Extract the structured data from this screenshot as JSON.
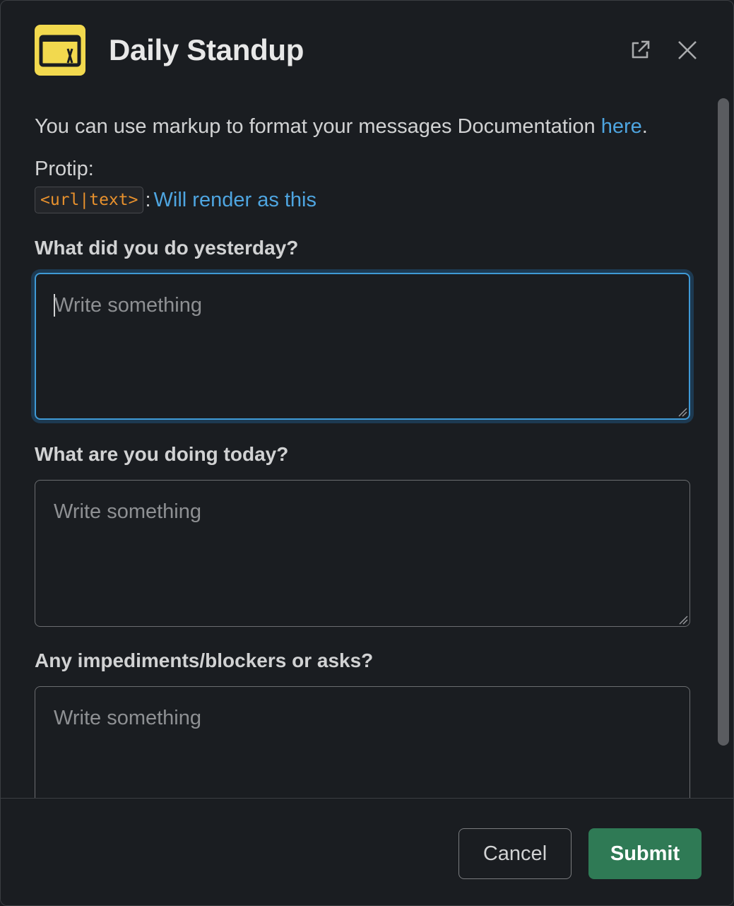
{
  "header": {
    "title": "Daily Standup",
    "app_icon": "app-window-icon",
    "brand_color": "#f2d94e",
    "open_external_icon": "external-link-icon",
    "close_icon": "close-icon"
  },
  "intro": {
    "text_before": "You can use markup to format your messages Documentation ",
    "link_text": "here",
    "text_after": "."
  },
  "protip": {
    "label": "Protip:",
    "code": "<url|text>",
    "separator": ":",
    "example_link": "Will render as this"
  },
  "fields": [
    {
      "label": "What did you do yesterday?",
      "placeholder": "Write something",
      "value": ""
    },
    {
      "label": "What are you doing today?",
      "placeholder": "Write something",
      "value": ""
    },
    {
      "label": "Any impediments/blockers or asks?",
      "placeholder": "Write something",
      "value": ""
    }
  ],
  "footer": {
    "cancel_label": "Cancel",
    "submit_label": "Submit",
    "submit_color": "#2f7a55"
  }
}
